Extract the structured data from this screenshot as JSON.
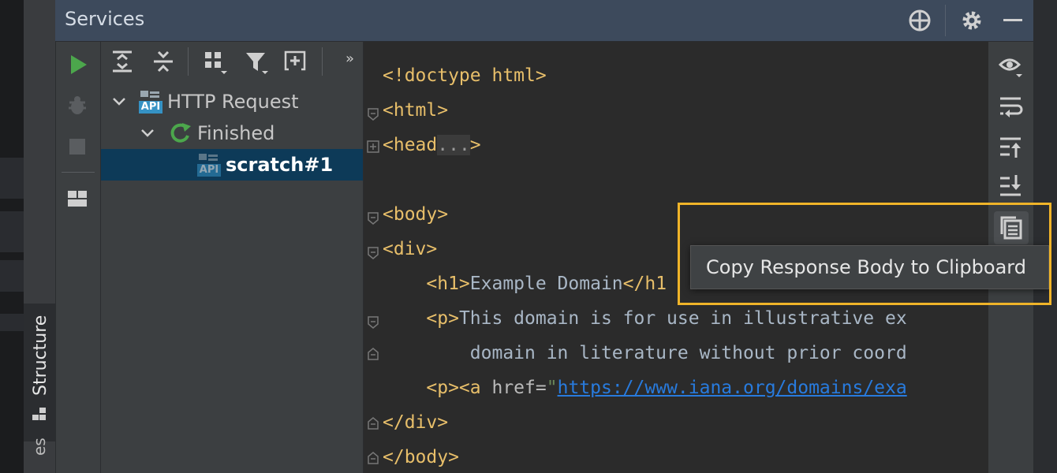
{
  "header": {
    "title": "Services"
  },
  "side_tabs": {
    "structure": "Structure",
    "services_partial": "es"
  },
  "tree": {
    "items": [
      {
        "label": "HTTP Request",
        "badge": "API"
      },
      {
        "label": "Finished"
      },
      {
        "label": "scratch#1",
        "badge": "API"
      }
    ]
  },
  "editor": {
    "lines": [
      {
        "tag": "<!doctype html>"
      },
      {
        "tag": "<html>"
      },
      {
        "tag": "<head",
        "collapsed": "...",
        "tag_end": ">"
      },
      {
        "tag": ""
      },
      {
        "tag": "<body>"
      },
      {
        "tag": "<div>"
      },
      {
        "indent": "    ",
        "tag": "<h1>",
        "text": "Example Domain",
        "tag_end": "</h1"
      },
      {
        "indent": "    ",
        "tag": "<p>",
        "text": "This domain is for use in illustrative ex"
      },
      {
        "indent": "        ",
        "text": "domain in literature without prior coord"
      },
      {
        "indent": "    ",
        "tag": "<p><a ",
        "attr": "href=",
        "q": "\"",
        "link": "https://www.iana.org/domains/exa"
      },
      {
        "tag": "</div>"
      },
      {
        "tag": "</body>"
      }
    ]
  },
  "tooltip": {
    "text": "Copy Response Body to Clipboard"
  },
  "colors": {
    "accent_highlight": "#f0b429",
    "run_green": "#4ca74c",
    "selected_row": "#0d3a58"
  }
}
